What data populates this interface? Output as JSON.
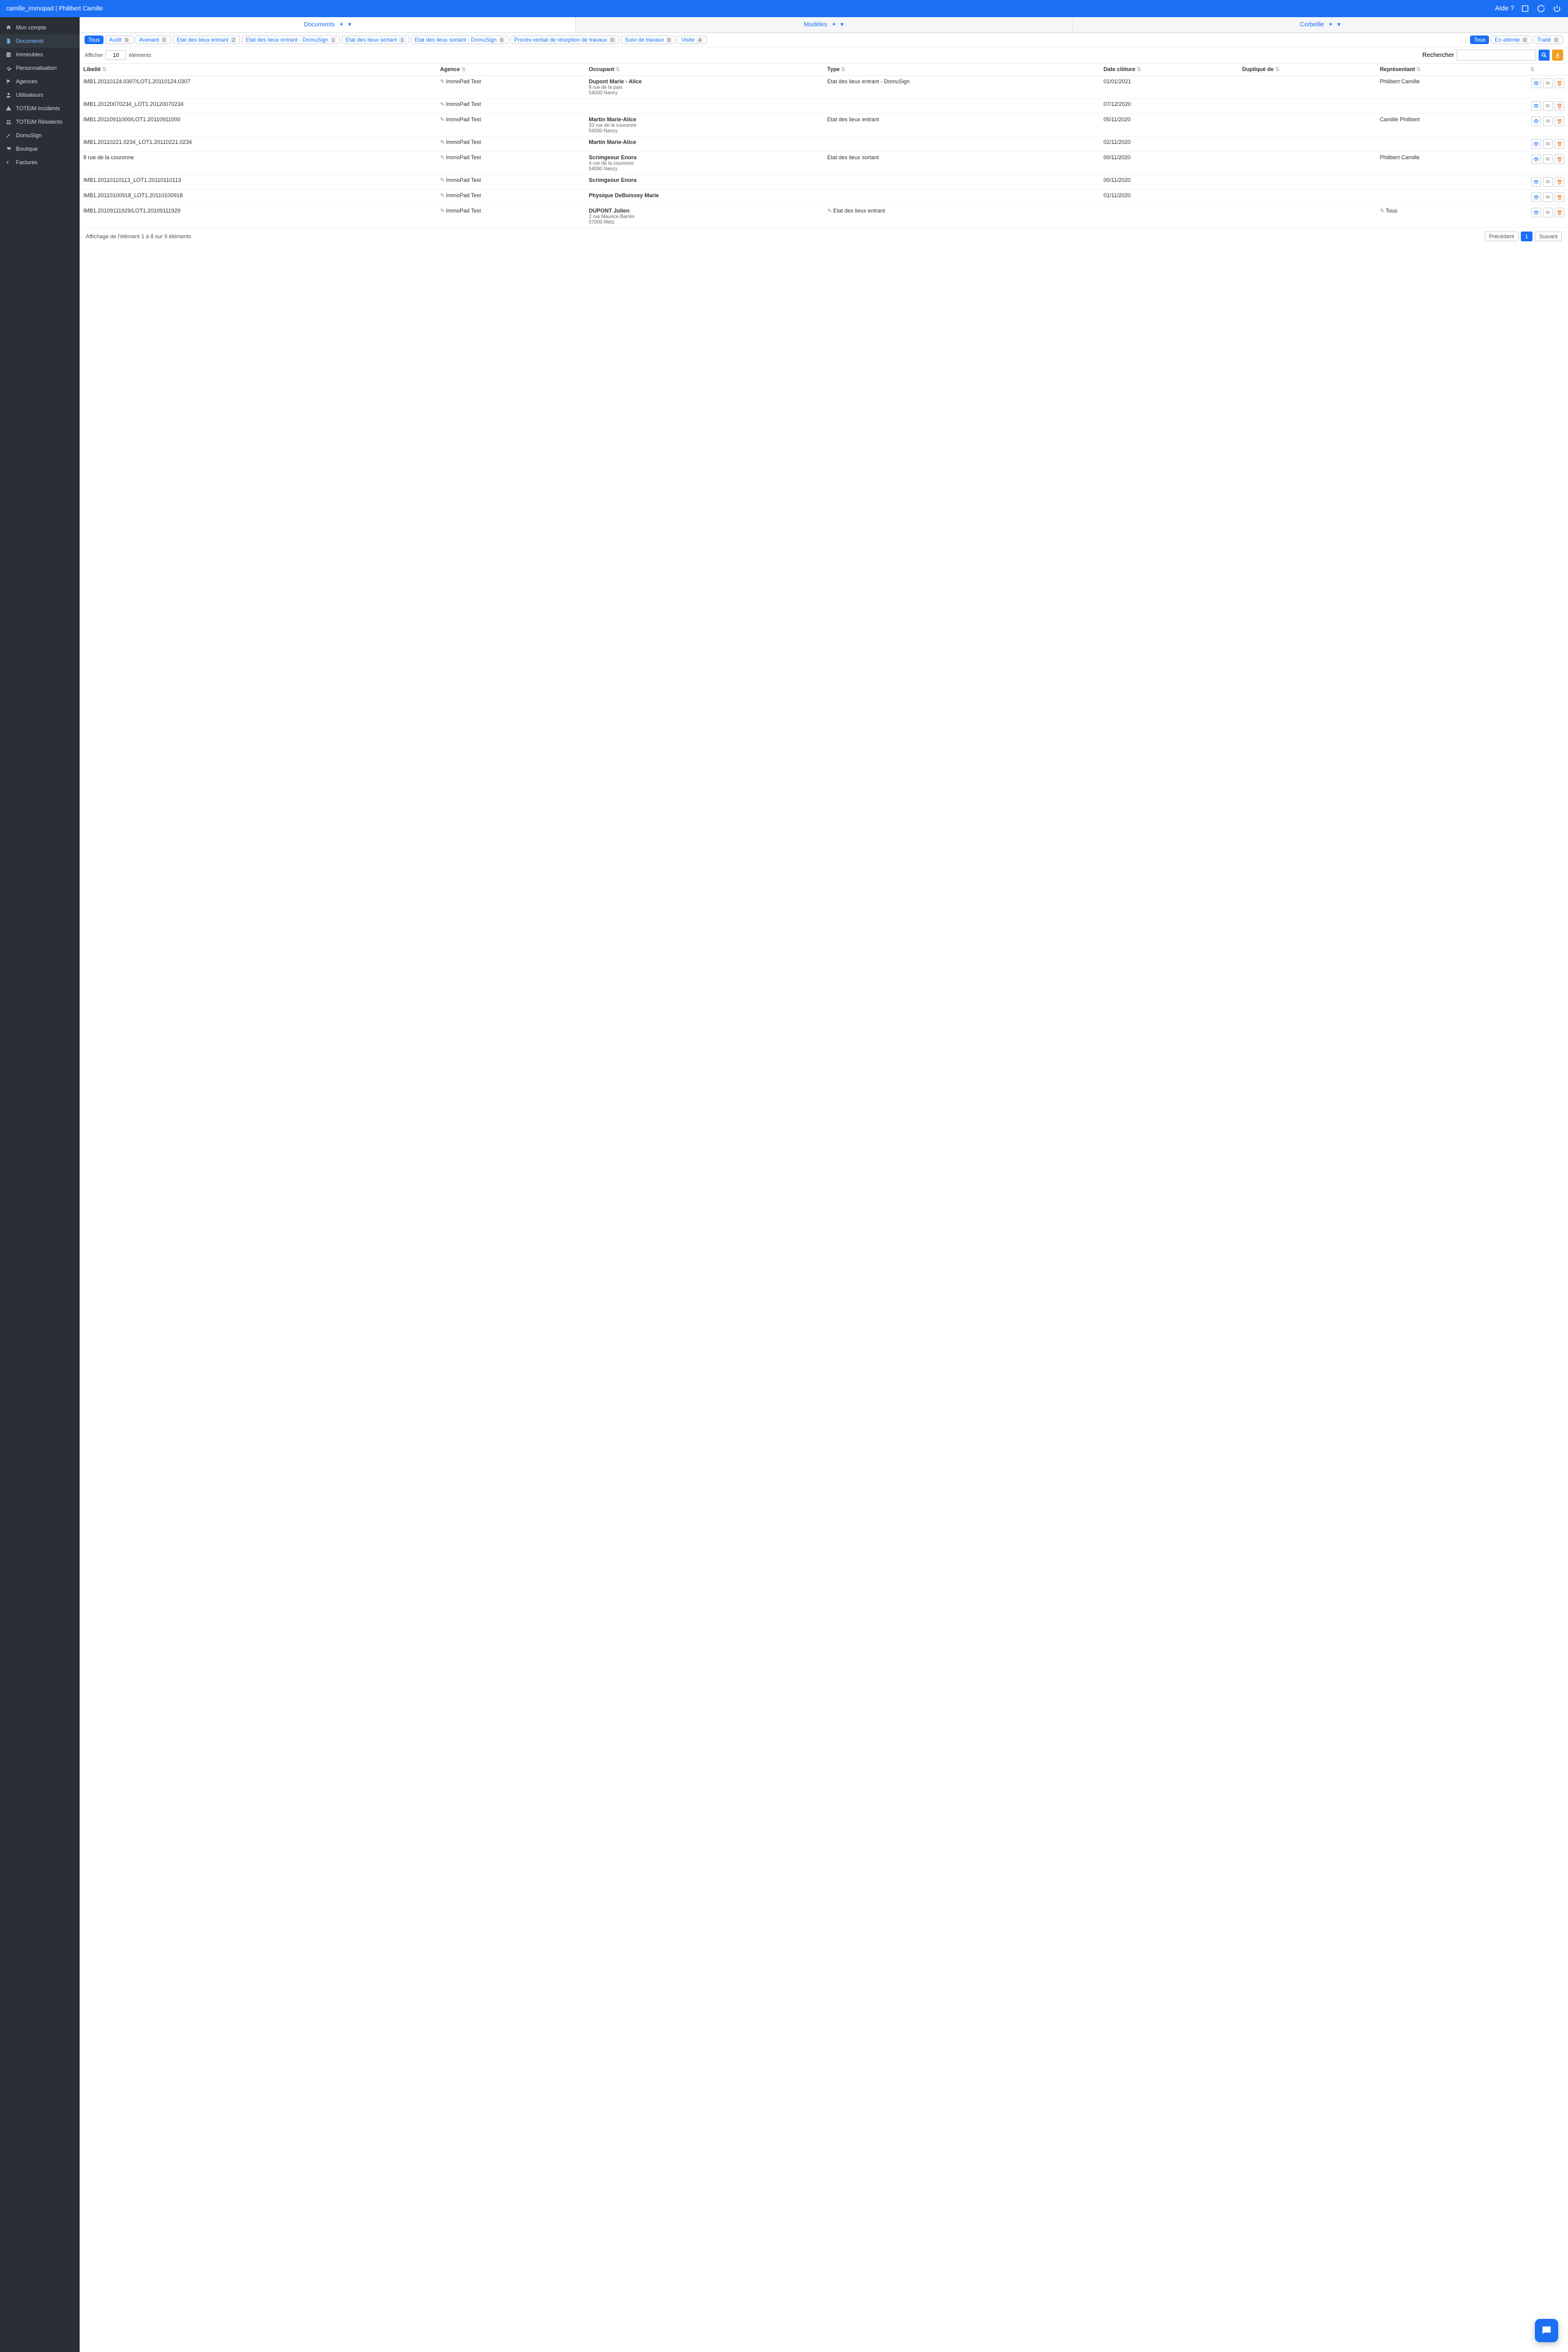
{
  "topbar": {
    "title": "camille_immopad | Philibert Camille",
    "help": "Aide ?"
  },
  "sidebar": {
    "items": [
      {
        "label": "Mon compte",
        "icon": "home"
      },
      {
        "label": "Documents",
        "icon": "doc",
        "active": true
      },
      {
        "label": "Immeubles",
        "icon": "building"
      },
      {
        "label": "Personnalisation",
        "icon": "cog"
      },
      {
        "label": "Agences",
        "icon": "flag"
      },
      {
        "label": "Utilisateurs",
        "icon": "user"
      },
      {
        "label": "TOTEiM Incidents",
        "icon": "alert"
      },
      {
        "label": "TOTEiM Résidents",
        "icon": "group"
      },
      {
        "label": "DomuSign",
        "icon": "pen"
      },
      {
        "label": "Boutique",
        "icon": "cart"
      },
      {
        "label": "Factures",
        "icon": "euro"
      }
    ]
  },
  "tabs": [
    {
      "label": "Documents",
      "active": true
    },
    {
      "label": "Modèles"
    },
    {
      "label": "Corbeille"
    }
  ],
  "type_filters": [
    {
      "label": "Tous",
      "primary": true,
      "count": ""
    },
    {
      "label": "Audit",
      "count": "0"
    },
    {
      "label": "Avenant",
      "count": "0"
    },
    {
      "label": "Etat des lieux entrant",
      "count": "2"
    },
    {
      "label": "Etat des lieux entrant - DomuSign",
      "count": "1"
    },
    {
      "label": "Etat des lieux sortant",
      "count": "1"
    },
    {
      "label": "Etat des lieux sortant - DomuSign",
      "count": "0"
    },
    {
      "label": "Procès-verbal de réception de travaux",
      "count": "0"
    },
    {
      "label": "Suivi de travaux",
      "count": "0"
    },
    {
      "label": "Visite",
      "count": "4"
    }
  ],
  "status_filters": [
    {
      "label": "Tous",
      "primary": true,
      "count": ""
    },
    {
      "label": "En attente",
      "count": "0"
    },
    {
      "label": "Traité",
      "count": "0"
    }
  ],
  "toolbar": {
    "display_prefix": "Afficher",
    "display_value": "10",
    "display_suffix": "éléments",
    "search_label": "Rechercher"
  },
  "columns": [
    "Libellé",
    "Agence",
    "Occupant",
    "Type",
    "Date clôture",
    "Dupliqué de",
    "Représentant",
    ""
  ],
  "rows": [
    {
      "libelle": "IMB1.20110124.0307/LOT1.20110124.0307",
      "agence": "ImmoPad Test",
      "occ_name": "Dupont Marie - Alice",
      "occ_addr1": "8 rue de la paix",
      "occ_addr2": "54000 Nancy",
      "type": "Etat des lieux entrant - DomuSign",
      "date": "01/01/2021",
      "rep": "Philibert Camille"
    },
    {
      "libelle": "IMB1.20120070234_LOT1.20120070234",
      "agence": "ImmoPad Test",
      "occ_name": "",
      "occ_addr1": "",
      "occ_addr2": "",
      "type": "",
      "date": "07/12/2020",
      "rep": ""
    },
    {
      "libelle": "IMB1.20110911000/LOT1.20110911000",
      "agence": "ImmoPad Test",
      "occ_name": "Martin Marie-Alice",
      "occ_addr1": "33 rue de la couronne",
      "occ_addr2": "54000 Nancy",
      "type": "Etat des lieux entrant",
      "date": "05/11/2020",
      "rep": "Camille Philibert"
    },
    {
      "libelle": "IMB1.20110221.0234_LOT1.20110221.0234",
      "agence": "ImmoPad Test",
      "occ_name": "Martin Marie-Alice",
      "occ_addr1": "",
      "occ_addr2": "",
      "type": "",
      "date": "02/11/2020",
      "rep": ""
    },
    {
      "libelle": "8 rue de la couronne",
      "agence": "ImmoPad Test",
      "occ_name": "Scrimgeour Enora",
      "occ_addr1": "4 rue de la couronne",
      "occ_addr2": "54000 Nancy",
      "type": "Etat des lieux sortant",
      "date": "00/11/2020",
      "rep": "Philibert Camille"
    },
    {
      "libelle": "IMB1.20110110113_LOT1.20110110113",
      "agence": "ImmoPad Test",
      "occ_name": "Scrimgeour Enora",
      "occ_addr1": "",
      "occ_addr2": "",
      "type": "",
      "date": "00/11/2020",
      "rep": ""
    },
    {
      "libelle": "IMB1.20110100918_LOT1.20110100918",
      "agence": "ImmoPad Test",
      "occ_name": "Physique DeBoissey Marie",
      "occ_addr1": "",
      "occ_addr2": "",
      "type": "",
      "date": "01/11/2020",
      "rep": ""
    },
    {
      "libelle": "IMB1.20109111929/LOT1.20109111929",
      "agence": "ImmoPad Test",
      "occ_name": "DUPONT Julien",
      "occ_addr1": "2 rue Maurice Barrès",
      "occ_addr2": "57000 Metz",
      "type": "Etat des lieux entrant",
      "type_icon": true,
      "date": "",
      "rep": "Tous",
      "rep_icon": true
    }
  ],
  "footer": {
    "summary": "Affichage de l'élément 1 à 8 sur 9 éléments",
    "prev": "Précédent",
    "next": "Suivant",
    "page": "1"
  }
}
